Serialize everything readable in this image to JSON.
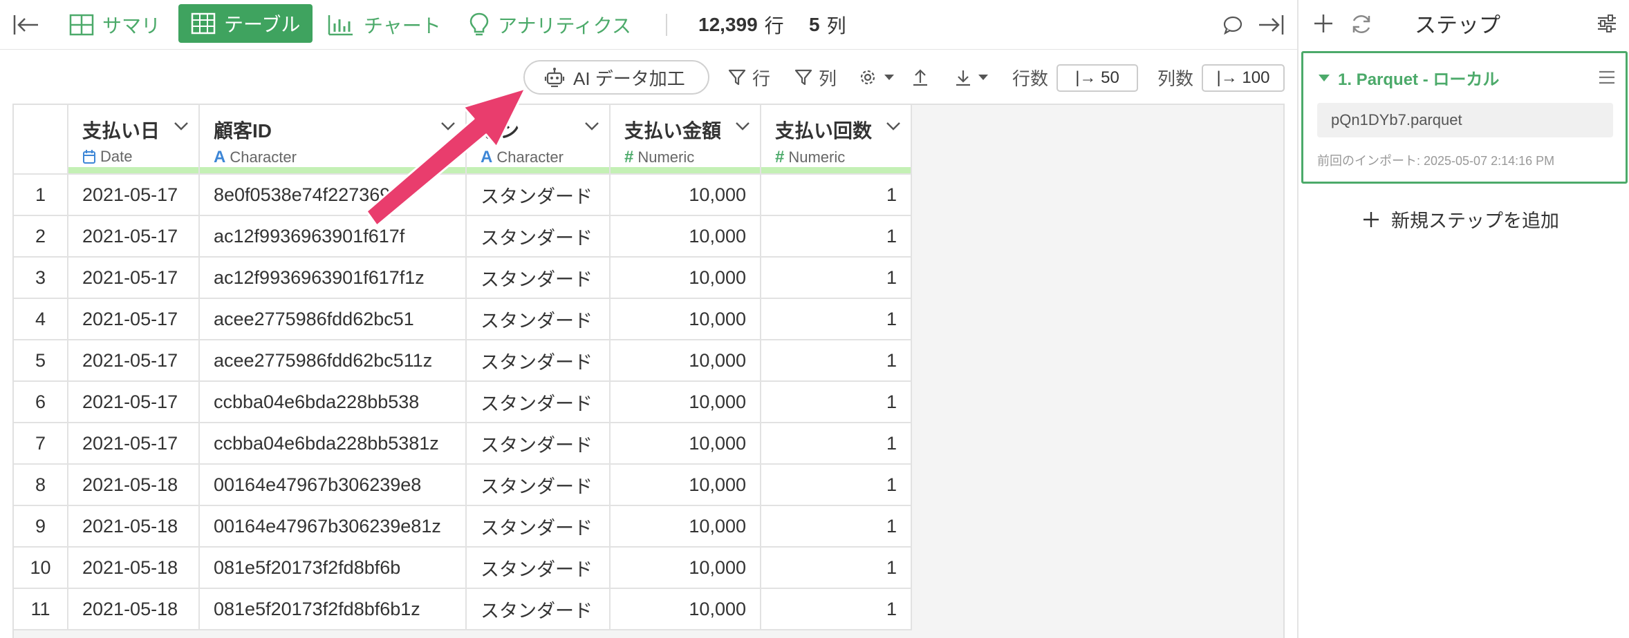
{
  "nav": {
    "summary": "サマリ",
    "table": "テーブル",
    "chart": "チャート",
    "analytics": "アナリティクス",
    "row_count": "12,399",
    "row_unit": "行",
    "col_count": "5",
    "col_unit": "列"
  },
  "toolbar": {
    "ai_button": "AI データ加工",
    "row_filter": "行",
    "col_filter": "列",
    "rows_label": "行数",
    "rows_value": "|→ 50",
    "cols_label": "列数",
    "cols_value": "|→ 100"
  },
  "table": {
    "columns": [
      {
        "title": "支払い日",
        "type": "Date"
      },
      {
        "title": "顧客ID",
        "type": "Character"
      },
      {
        "title": "ラン",
        "type": "Character"
      },
      {
        "title": "支払い金額",
        "type": "Numeric"
      },
      {
        "title": "支払い回数",
        "type": "Numeric"
      }
    ],
    "rows": [
      [
        "1",
        "2021-05-17",
        "8e0f0538e74f227369c",
        "スタンダード",
        "10,000",
        "1"
      ],
      [
        "2",
        "2021-05-17",
        "ac12f9936963901f617f",
        "スタンダード",
        "10,000",
        "1"
      ],
      [
        "3",
        "2021-05-17",
        "ac12f9936963901f617f1z",
        "スタンダード",
        "10,000",
        "1"
      ],
      [
        "4",
        "2021-05-17",
        "acee2775986fdd62bc51",
        "スタンダード",
        "10,000",
        "1"
      ],
      [
        "5",
        "2021-05-17",
        "acee2775986fdd62bc511z",
        "スタンダード",
        "10,000",
        "1"
      ],
      [
        "6",
        "2021-05-17",
        "ccbba04e6bda228bb538",
        "スタンダード",
        "10,000",
        "1"
      ],
      [
        "7",
        "2021-05-17",
        "ccbba04e6bda228bb5381z",
        "スタンダード",
        "10,000",
        "1"
      ],
      [
        "8",
        "2021-05-18",
        "00164e47967b306239e8",
        "スタンダード",
        "10,000",
        "1"
      ],
      [
        "9",
        "2021-05-18",
        "00164e47967b306239e81z",
        "スタンダード",
        "10,000",
        "1"
      ],
      [
        "10",
        "2021-05-18",
        "081e5f20173f2fd8bf6b",
        "スタンダード",
        "10,000",
        "1"
      ],
      [
        "11",
        "2021-05-18",
        "081e5f20173f2fd8bf6b1z",
        "スタンダード",
        "10,000",
        "1"
      ]
    ]
  },
  "panel": {
    "title": "ステップ",
    "step": {
      "title": "1. Parquet - ローカル",
      "file": "pQn1DYb7.parquet",
      "meta": "前回のインポート: 2025-05-07 2:14:16 PM"
    },
    "add_step": "新規ステップを追加"
  },
  "colors": {
    "accent": "#3fa35f",
    "quality_bar": "#c4f0b5",
    "arrow": "#e93d6d",
    "date_icon": "#3d86d6",
    "char_icon": "#3d86d6",
    "numeric_icon": "#4caa6a"
  }
}
